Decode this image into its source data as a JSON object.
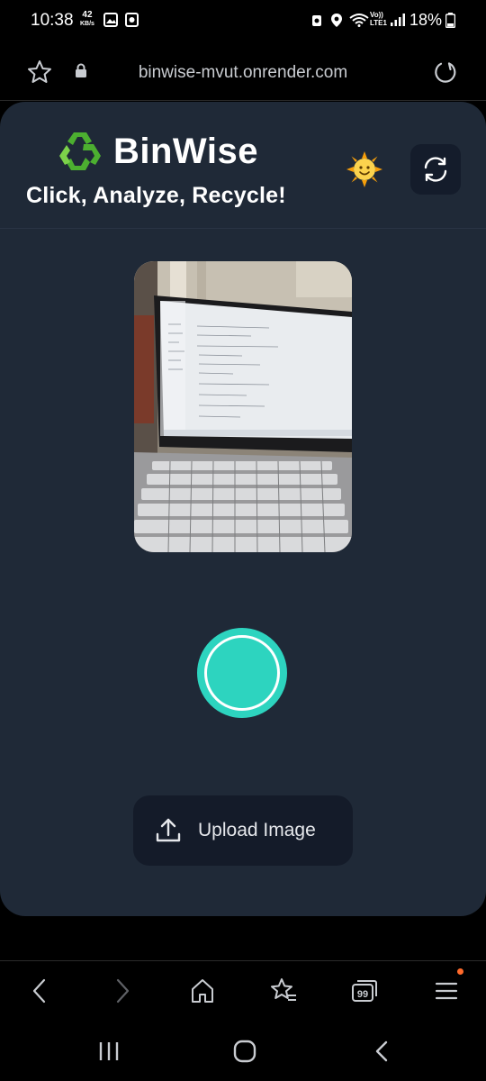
{
  "status_bar": {
    "time": "10:38",
    "net_speed_value": "42",
    "net_speed_unit": "KB/s",
    "network_label": "Vo)) LTE1",
    "battery": "18%"
  },
  "browser": {
    "url": "binwise-mvut.onrender.com"
  },
  "app": {
    "title": "BinWise",
    "tagline": "Click, Analyze, Recycle!",
    "upload_label": "Upload Image"
  },
  "colors": {
    "card_bg": "#1f2937",
    "accent": "#2dd4bf",
    "button_bg": "#141b29"
  },
  "icons": {
    "recycle": "recycle-icon",
    "theme": "sun-face-icon",
    "switch_camera": "switch-camera-icon",
    "upload": "upload-icon"
  }
}
